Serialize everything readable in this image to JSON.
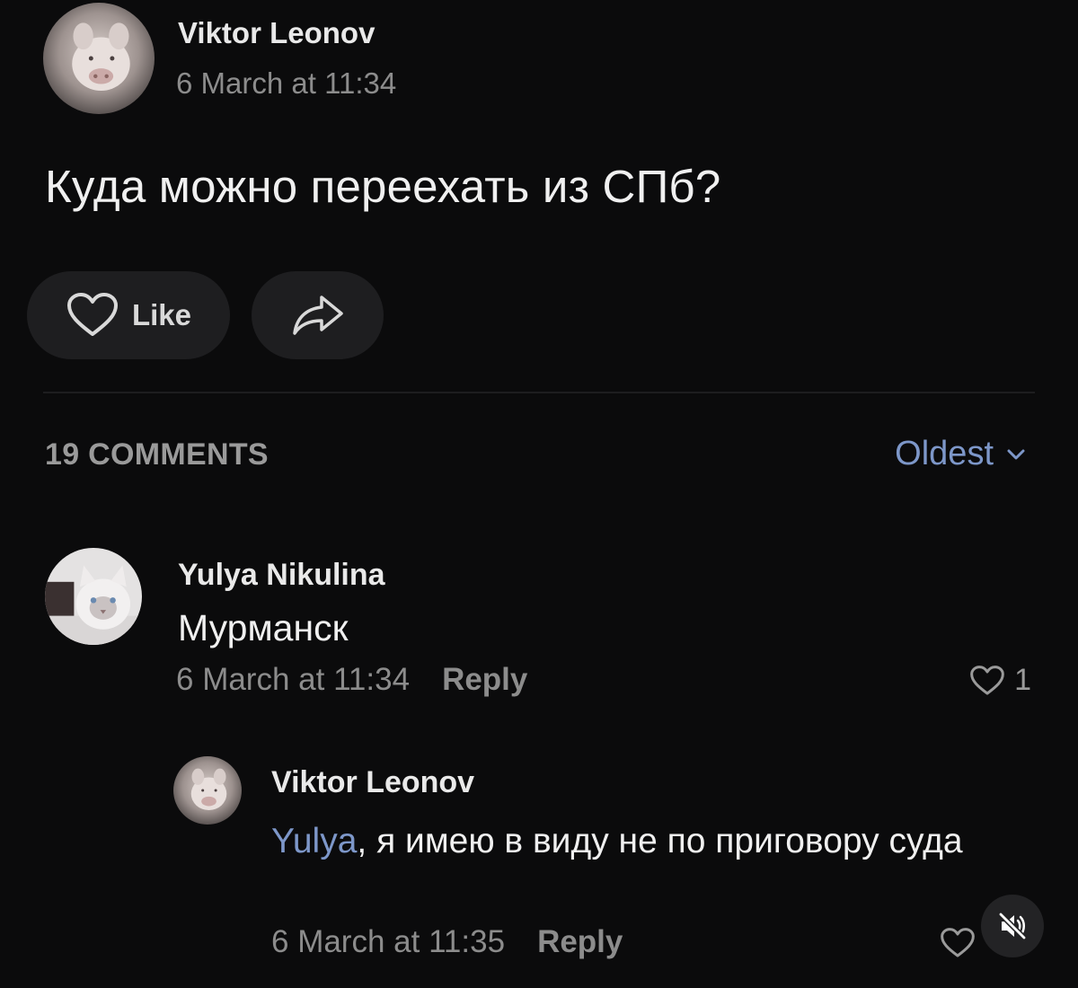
{
  "post": {
    "author": "Viktor Leonov",
    "time": "6 March at 11:34",
    "text": "Куда можно переехать из СПб?",
    "avatar_icon": "pig-avatar"
  },
  "actions": {
    "like_label": "Like",
    "like_icon": "heart-outline-icon",
    "share_icon": "share-arrow-icon"
  },
  "comments_header": {
    "count_label": "19 COMMENTS",
    "sort_label": "Oldest",
    "sort_icon": "chevron-down-icon"
  },
  "comments": [
    {
      "author": "Yulya Nikulina",
      "text": "Мурманск",
      "time": "6 March at 11:34",
      "reply_label": "Reply",
      "likes": "1",
      "avatar_icon": "cat-avatar"
    },
    {
      "author": "Viktor Leonov",
      "mention": "Yulya",
      "text": ", я имею в виду не по приговору суда",
      "time": "6 March at 11:35",
      "reply_label": "Reply",
      "avatar_icon": "pig-avatar"
    }
  ],
  "overlay": {
    "mute_icon": "muted-speaker-icon"
  },
  "colors": {
    "background": "#0b0b0c",
    "accent": "#7d97c9",
    "muted_text": "#8c8c8c",
    "button_bg": "#1e1e20"
  }
}
